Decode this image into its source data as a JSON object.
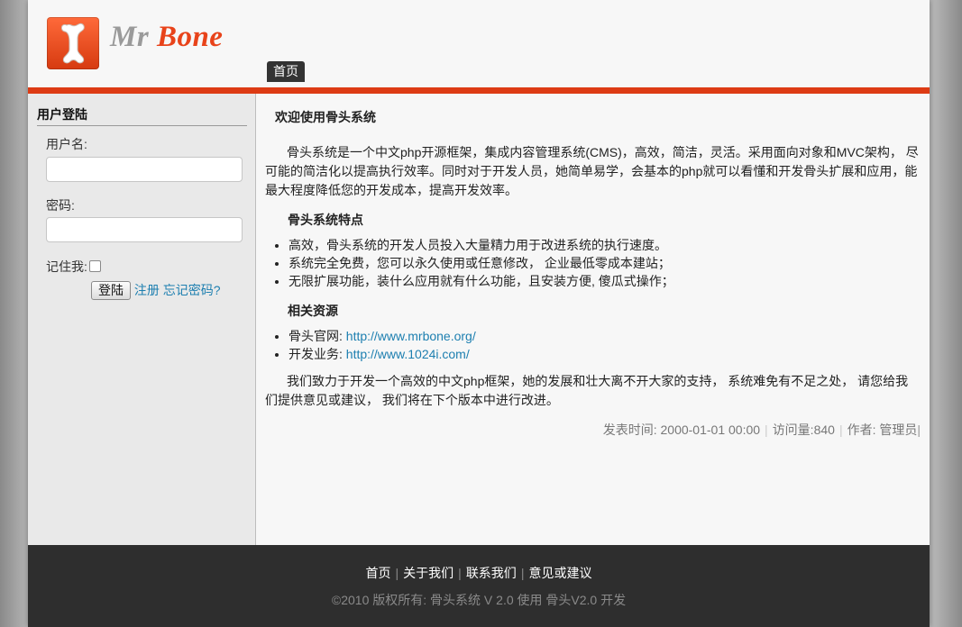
{
  "header": {
    "logo_mr": "Mr",
    "logo_bone": "Bone",
    "nav_home": "首页"
  },
  "sidebar": {
    "title": "用户登陆",
    "username_label": "用户名:",
    "username_value": "",
    "password_label": "密码:",
    "password_value": "",
    "remember_label": "记住我:",
    "login_button": "登陆",
    "register_link": "注册",
    "forgot_link": "忘记密码?"
  },
  "main": {
    "title": "欢迎使用骨头系统",
    "intro": "骨头系统是一个中文php开源框架，集成内容管理系统(CMS)，高效，简洁，灵活。采用面向对象和MVC架构， 尽可能的简洁化以提高执行效率。同时对于开发人员，她简单易学，会基本的php就可以看懂和开发骨头扩展和应用，能最大程度降低您的开发成本，提高开发效率。",
    "features_title": "骨头系统特点",
    "features": [
      "高效，骨头系统的开发人员投入大量精力用于改进系统的执行速度。",
      "系统完全免费，您可以永久使用或任意修改， 企业最低零成本建站；",
      "无限扩展功能，装什么应用就有什么功能，且安装方便, 傻瓜式操作；"
    ],
    "resources_title": "相关资源",
    "resources": [
      {
        "label": "骨头官网: ",
        "url": "http://www.mrbone.org/"
      },
      {
        "label": "开发业务: ",
        "url": "http://www.1024i.com/"
      }
    ],
    "closing": "我们致力于开发一个高效的中文php框架，她的发展和壮大离不开大家的支持， 系统难免有不足之处， 请您给我们提供意见或建议， 我们将在下个版本中进行改进。",
    "meta": {
      "published": "发表时间: 2000-01-01 00:00",
      "views": "访问量:840",
      "author": "作者: 管理员"
    }
  },
  "footer": {
    "nav": [
      "首页",
      "关于我们",
      "联系我们",
      "意见或建议"
    ],
    "copyright": "©2010 版权所有: 骨头系统 V 2.0   使用 骨头V2.0 开发"
  },
  "colors": {
    "accent": "#dd3b14",
    "link": "#1d7fb0",
    "footer_bg": "#2e2e2e"
  }
}
